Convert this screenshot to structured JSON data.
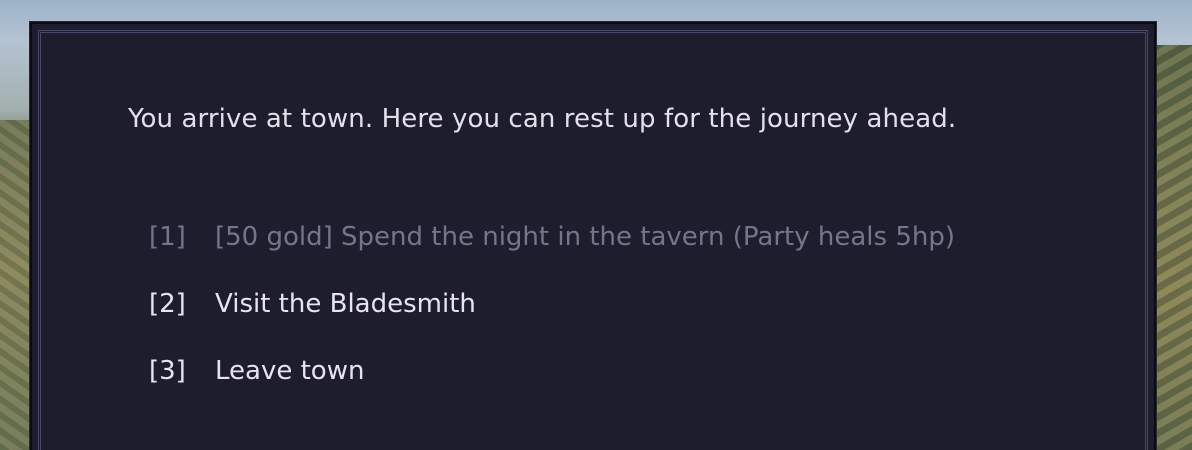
{
  "dialog": {
    "narration": "You arrive at town. Here you can rest up for the journey ahead.",
    "choices": [
      {
        "key": "[1]",
        "label": "[50 gold] Spend the night in the tavern (Party heals 5hp)",
        "state": "disabled"
      },
      {
        "key": "[2]",
        "label": "Visit the Bladesmith",
        "state": "enabled"
      },
      {
        "key": "[3]",
        "label": "Leave town",
        "state": "enabled"
      }
    ]
  },
  "colors": {
    "panel_background": "#1e1d2d",
    "panel_border": "#4a4868",
    "text_enabled": "#e6e4ee",
    "text_disabled": "#76748a"
  }
}
